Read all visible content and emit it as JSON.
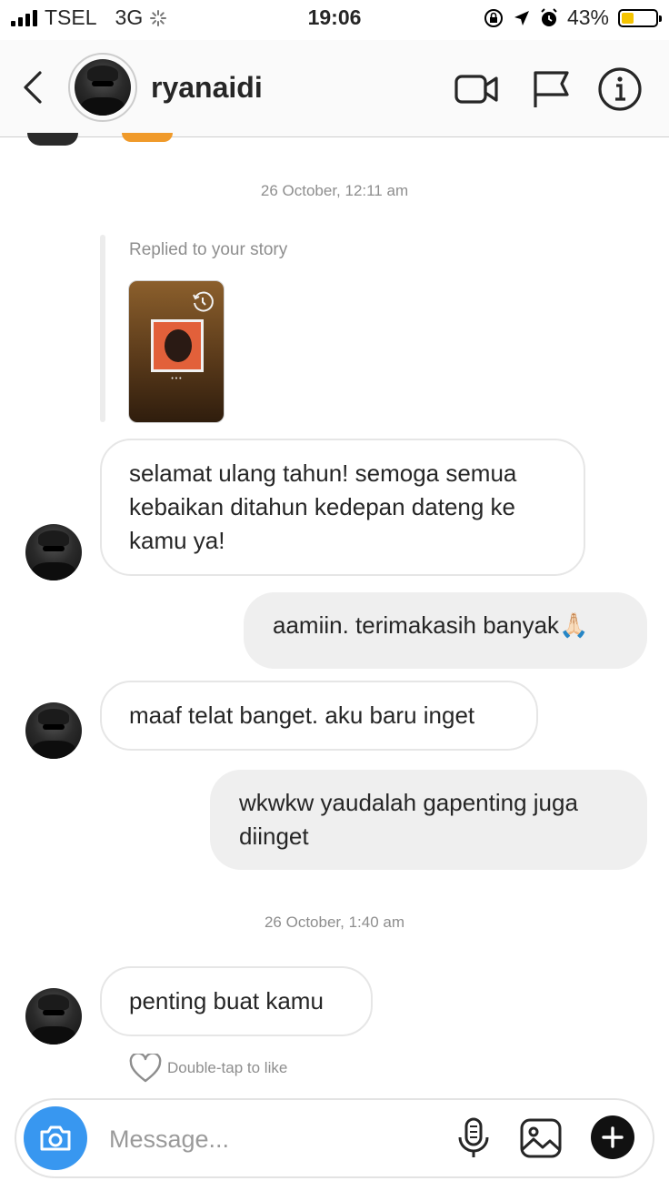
{
  "status_bar": {
    "carrier": "TSEL",
    "network": "3G",
    "time": "19:06",
    "battery_percent": "43%",
    "battery_level": 0.43,
    "battery_color": "#f5c400"
  },
  "header": {
    "username": "ryanaidi",
    "icons": [
      "back-chevron-icon",
      "video-call-icon",
      "flag-icon",
      "info-icon"
    ]
  },
  "conversation": {
    "timestamp_1": "26 October, 12:11 am",
    "story_reply_label": "Replied to your story",
    "messages": [
      {
        "from": "them",
        "text": "selamat ulang tahun! semoga semua kebaikan ditahun kedepan dateng ke kamu ya!"
      },
      {
        "from": "me",
        "text": "aamiin. terimakasih banyak🙏🏻"
      },
      {
        "from": "them",
        "text": "maaf telat banget. aku baru inget"
      },
      {
        "from": "me",
        "text": "wkwkw yaudalah gapenting juga diinget"
      }
    ],
    "timestamp_2": "26 October, 1:40 am",
    "last_message": {
      "from": "them",
      "text": "penting buat kamu"
    },
    "like_hint": "Double-tap to like"
  },
  "composer": {
    "placeholder": "Message...",
    "icons": [
      "camera-icon",
      "microphone-icon",
      "gallery-icon",
      "plus-icon"
    ]
  },
  "colors": {
    "accent_blue": "#3897f0",
    "sent_bubble": "#efefef",
    "timestamp_gray": "#8e8e8e"
  }
}
